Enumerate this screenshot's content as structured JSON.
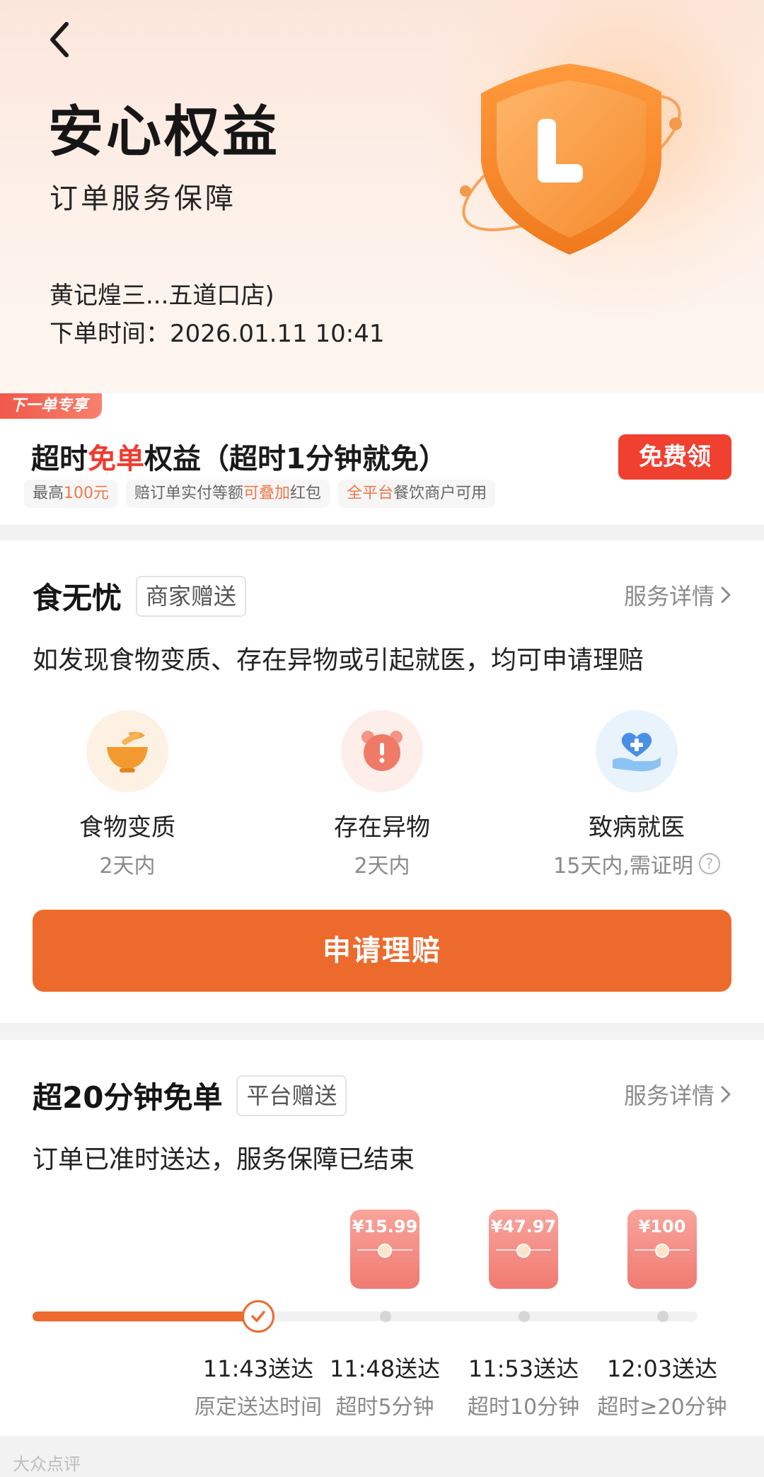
{
  "header": {
    "title": "安心权益",
    "subtitle": "订单服务保障",
    "store": "黄记煌三...五道口店)",
    "order_time": "下单时间：2026.01.11 10:41",
    "shield_letter": "L"
  },
  "coupon": {
    "ribbon": "下一单专享",
    "title_prefix": "超时",
    "title_highlight": "免单",
    "title_suffix": "权益（超时1分钟就免）",
    "tag1_prefix": "最高",
    "tag1_highlight": "100元",
    "tag2_prefix": "赔订单实付等额",
    "tag2_highlight": "可叠加",
    "tag2_suffix": "红包",
    "tag3_highlight": "全平台",
    "tag3_suffix": "餐饮商户可用",
    "button": "免费领"
  },
  "food_card": {
    "name": "食无忧",
    "badge": "商家赠送",
    "detail": "服务详情",
    "desc": "如发现食物变质、存在异物或引起就医，均可申请理赔",
    "features": [
      {
        "name": "食物变质",
        "sub": "2天内",
        "icon": "bowl-icon"
      },
      {
        "name": "存在异物",
        "sub": "2天内",
        "icon": "alarm-clock-icon"
      },
      {
        "name": "致病就医",
        "sub": "15天内,需证明",
        "icon": "heart-hand-icon"
      }
    ],
    "help": "?",
    "apply_button": "申请理赔"
  },
  "timeout_card": {
    "name": "超20分钟免单",
    "badge": "平台赠送",
    "detail": "服务详情",
    "desc": "订单已准时送达，服务保障已结束",
    "progress": 0.25,
    "packets": [
      "¥15.99",
      "¥47.97",
      "¥100"
    ],
    "milestones": [
      {
        "time": "11:43送达",
        "sub": "原定送达时间"
      },
      {
        "time": "11:48送达",
        "sub": "超时5分钟"
      },
      {
        "time": "11:53送达",
        "sub": "超时10分钟"
      },
      {
        "time": "12:03送达",
        "sub": "超时≥20分钟"
      }
    ]
  },
  "watermark": "大众点评",
  "colors": {
    "accent": "#ed6a2d",
    "red": "#ef4030",
    "muted": "#8a8a8a"
  }
}
